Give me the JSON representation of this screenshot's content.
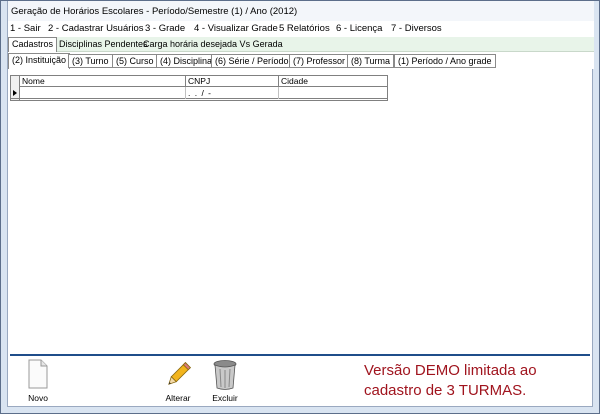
{
  "window": {
    "title": "Geração de Horários Escolares - Período/Semestre (1) / Ano (2012)"
  },
  "menu": [
    "1 - Sair",
    "2 - Cadastrar Usuários",
    "3 - Grade",
    "4 - Visualizar Grade",
    "5 Relatórios",
    "6 - Licença",
    "7 - Diversos"
  ],
  "tabs_main": [
    "Cadastros",
    "Disciplinas Pendentes",
    "Carga horária desejada Vs Gerada"
  ],
  "tabs_sub": [
    "(2) Instituição",
    "(3) Turno",
    "(5) Curso",
    "(4) Disciplina",
    "(6) Série / Período",
    "(7) Professor",
    "(8) Turma",
    "(1) Período / Ano grade"
  ],
  "grid": {
    "columns": [
      "Nome",
      "CNPJ",
      "Cidade"
    ],
    "rows": [
      {
        "nome": "",
        "cnpj": " .  .  /  -",
        "cidade": ""
      }
    ]
  },
  "toolbar": {
    "new_label": "Novo",
    "edit_label": "Alterar",
    "delete_label": "Excluir"
  },
  "demo_notice": "Versão DEMO limitada ao cadastro de 3 TURMAS."
}
